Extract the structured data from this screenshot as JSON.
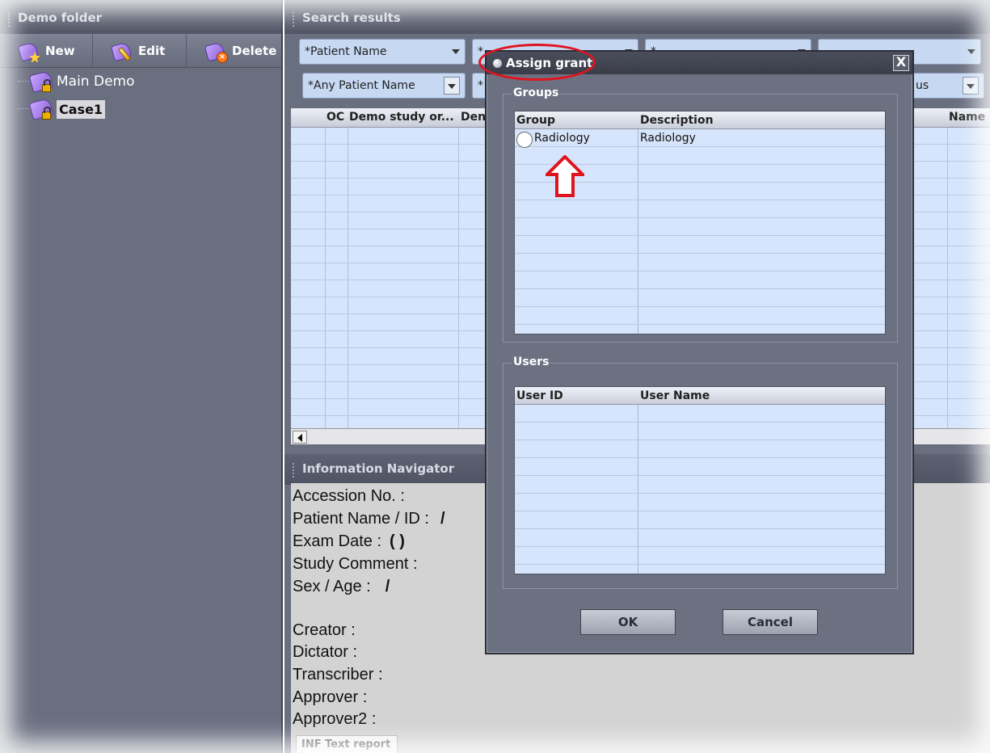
{
  "left_panel": {
    "title": "Demo folder",
    "toolbar": {
      "new_label": "New",
      "edit_label": "Edit",
      "delete_label": "Delete"
    },
    "tree": [
      {
        "label": "Main Demo"
      },
      {
        "label": "Case1",
        "selected": true
      }
    ]
  },
  "search_panel": {
    "title": "Search results",
    "filters_row1": [
      {
        "value": "*Patient Name"
      },
      {
        "value": "*"
      },
      {
        "value": "*"
      },
      {
        "value": ""
      }
    ],
    "filters_row2": [
      {
        "value": "*Any Patient Name"
      },
      {
        "value": "*"
      },
      {
        "value": "us"
      }
    ],
    "columns": [
      "OC",
      "Demo study or...",
      "Den",
      "Name"
    ]
  },
  "info_navigator": {
    "title": "Information Navigator",
    "fields": [
      {
        "label": "Accession No. :",
        "value": ""
      },
      {
        "label": "Patient Name / ID :",
        "value": "/"
      },
      {
        "label": "Exam Date :",
        "value": "(  )"
      },
      {
        "label": "Study Comment :",
        "value": ""
      },
      {
        "label": "Sex / Age :",
        "value": "/"
      },
      {
        "label": "Creator :",
        "value": ""
      },
      {
        "label": "Dictator :",
        "value": ""
      },
      {
        "label": "Transcriber :",
        "value": ""
      },
      {
        "label": "Approver :",
        "value": ""
      },
      {
        "label": "Approver2 :",
        "value": ""
      }
    ],
    "report_tab": "INF Text report"
  },
  "dialog": {
    "title": "Assign grant",
    "close_glyph": "X",
    "groups": {
      "legend": "Groups",
      "columns": [
        "Group",
        "Description"
      ],
      "rows": [
        {
          "group": "Radiology",
          "description": "Radiology"
        }
      ]
    },
    "users": {
      "legend": "Users",
      "columns": [
        "User ID",
        "User Name"
      ],
      "rows": []
    },
    "ok_label": "OK",
    "cancel_label": "Cancel"
  },
  "colors": {
    "annotation_red": "#e0141e",
    "panel_bg": "#6a6f80",
    "grid_bg": "#d6e5fb"
  },
  "annotations": {
    "title_highlight": "red-ellipse",
    "radio_pointer": "red-up-arrow"
  }
}
